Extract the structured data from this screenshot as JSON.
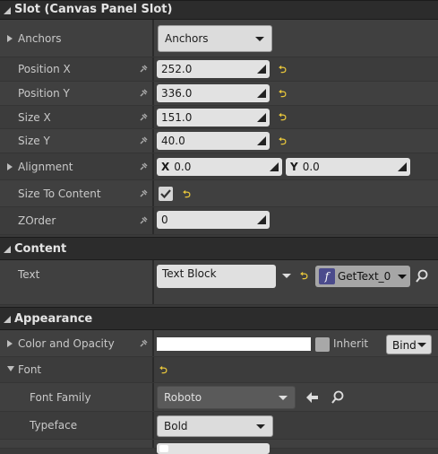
{
  "slot": {
    "title": "Slot (Canvas Panel Slot)",
    "anchors": {
      "label": "Anchors",
      "value": "Anchors"
    },
    "position_x": {
      "label": "Position X",
      "value": "252.0"
    },
    "position_y": {
      "label": "Position Y",
      "value": "336.0"
    },
    "size_x": {
      "label": "Size X",
      "value": "151.0"
    },
    "size_y": {
      "label": "Size Y",
      "value": "40.0"
    },
    "alignment": {
      "label": "Alignment",
      "x_axis": "X",
      "x_value": "0.0",
      "y_axis": "Y",
      "y_value": "0.0"
    },
    "size_to_content": {
      "label": "Size To Content",
      "checked": true
    },
    "zorder": {
      "label": "ZOrder",
      "value": "0"
    }
  },
  "content": {
    "title": "Content",
    "text": {
      "label": "Text",
      "value": "Text Block",
      "binding": "GetText_0",
      "func_glyph": "f"
    }
  },
  "appearance": {
    "title": "Appearance",
    "color_and_opacity": {
      "label": "Color and Opacity",
      "inherit_label": "Inherit",
      "bind_label": "Bind",
      "color": "#ffffff"
    },
    "font": {
      "label": "Font"
    },
    "font_family": {
      "label": "Font Family",
      "value": "Roboto"
    },
    "typeface": {
      "label": "Typeface",
      "value": "Bold"
    }
  },
  "colors": {
    "reset": "#e8c63b",
    "header_bg": "#2c2c2c",
    "panel_bg": "#3a3a3a"
  }
}
